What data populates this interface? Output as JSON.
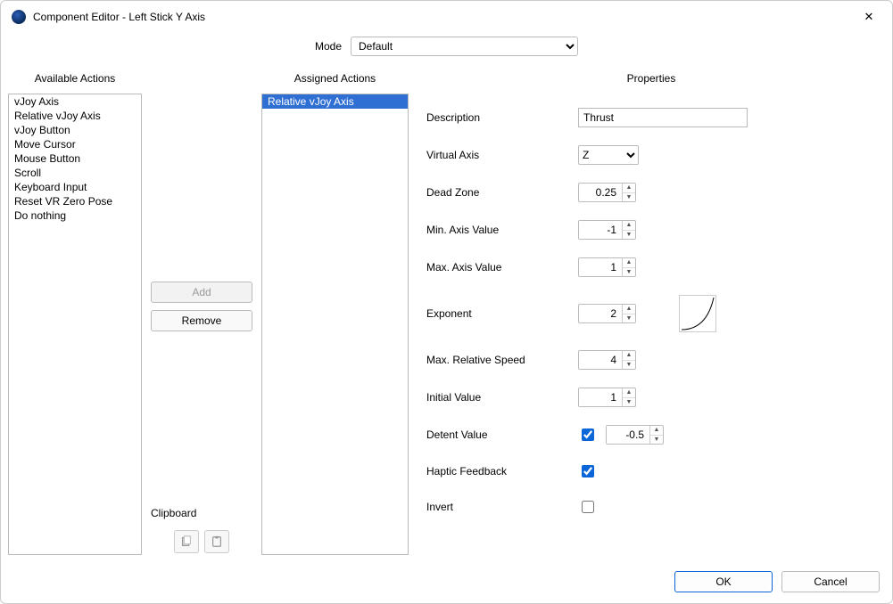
{
  "window": {
    "title": "Component Editor - Left Stick Y Axis"
  },
  "mode": {
    "label": "Mode",
    "value": "Default"
  },
  "headers": {
    "available": "Available Actions",
    "assigned": "Assigned Actions",
    "properties": "Properties"
  },
  "available_actions": [
    "vJoy Axis",
    "Relative vJoy Axis",
    "vJoy Button",
    "Move Cursor",
    "Mouse Button",
    "Scroll",
    "Keyboard Input",
    "Reset VR Zero Pose",
    "Do nothing"
  ],
  "assigned_actions": [
    {
      "label": "Relative vJoy Axis",
      "selected": true
    }
  ],
  "middle": {
    "add": "Add",
    "remove": "Remove",
    "clipboard": "Clipboard"
  },
  "properties": {
    "description": {
      "label": "Description",
      "value": "Thrust"
    },
    "virtual_axis": {
      "label": "Virtual Axis",
      "value": "Z"
    },
    "dead_zone": {
      "label": "Dead Zone",
      "value": "0.25"
    },
    "min_axis": {
      "label": "Min. Axis Value",
      "value": "-1"
    },
    "max_axis": {
      "label": "Max. Axis Value",
      "value": "1"
    },
    "exponent": {
      "label": "Exponent",
      "value": "2"
    },
    "max_rel_speed": {
      "label": "Max. Relative Speed",
      "value": "4"
    },
    "initial_value": {
      "label": "Initial Value",
      "value": "1"
    },
    "detent": {
      "label": "Detent Value",
      "checked": true,
      "value": "-0.5"
    },
    "haptic": {
      "label": "Haptic Feedback",
      "checked": true
    },
    "invert": {
      "label": "Invert",
      "checked": false
    }
  },
  "footer": {
    "ok": "OK",
    "cancel": "Cancel"
  }
}
